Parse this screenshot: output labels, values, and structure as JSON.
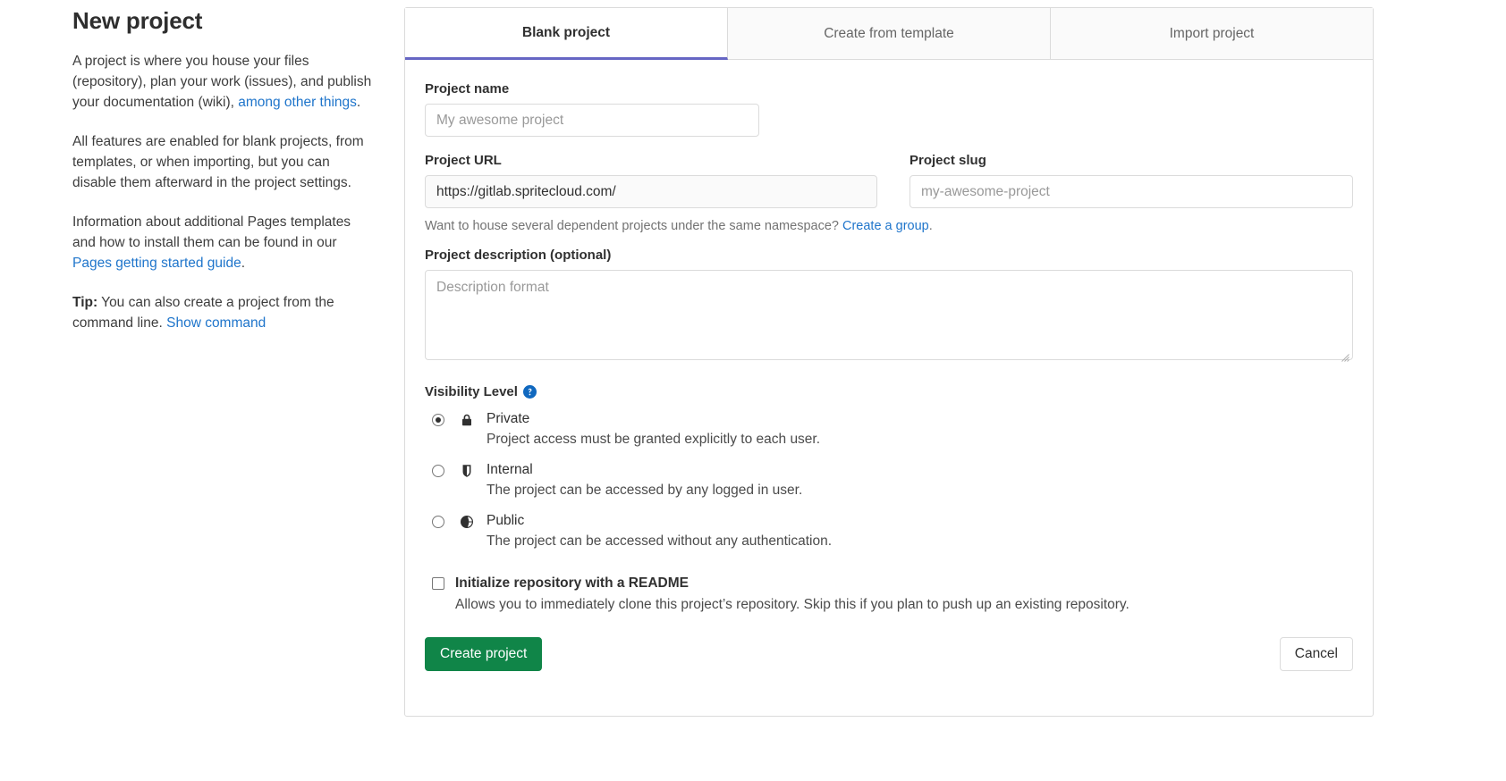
{
  "sidebar": {
    "title": "New project",
    "p1_a": "A project is where you house your files (repository), plan your work (issues), and publish your documentation (wiki), ",
    "p1_link": "among other things",
    "p1_b": ".",
    "p2": "All features are enabled for blank projects, from templates, or when importing, but you can disable them afterward in the project settings.",
    "p3_a": "Information about additional Pages templates and how to install them can be found in our ",
    "p3_link": "Pages getting started guide",
    "p3_b": ".",
    "tip_label": "Tip:",
    "tip_text": " You can also create a project from the command line. ",
    "tip_link": "Show command"
  },
  "tabs": [
    {
      "label": "Blank project",
      "active": true
    },
    {
      "label": "Create from template",
      "active": false
    },
    {
      "label": "Import project",
      "active": false
    }
  ],
  "form": {
    "project_name_label": "Project name",
    "project_name_value": "",
    "project_name_placeholder": "My awesome project",
    "project_url_label": "Project URL",
    "project_url_value": "https://gitlab.spritecloud.com/",
    "project_slug_label": "Project slug",
    "project_slug_value": "",
    "project_slug_placeholder": "my-awesome-project",
    "namespace_hint_text": "Want to house several dependent projects under the same namespace? ",
    "namespace_hint_link": "Create a group",
    "namespace_hint_end": ".",
    "description_label": "Project description (optional)",
    "description_value": "",
    "description_placeholder": "Description format",
    "visibility_label": "Visibility Level",
    "help_icon": "question-circle-icon",
    "visibility_options": [
      {
        "id": "private",
        "icon": "lock-icon",
        "name": "Private",
        "desc": "Project access must be granted explicitly to each user.",
        "selected": true
      },
      {
        "id": "internal",
        "icon": "shield-icon",
        "name": "Internal",
        "desc": "The project can be accessed by any logged in user.",
        "selected": false
      },
      {
        "id": "public",
        "icon": "globe-icon",
        "name": "Public",
        "desc": "The project can be accessed without any authentication.",
        "selected": false
      }
    ],
    "readme_label": "Initialize repository with a README",
    "readme_checked": false,
    "readme_desc": "Allows you to immediately clone this project’s repository. Skip this if you plan to push up an existing repository.",
    "create_button": "Create project",
    "cancel_button": "Cancel"
  },
  "colors": {
    "link": "#1f75cb",
    "active_tab_underline": "#6666c4",
    "create_button_bg": "#108548",
    "help_icon_blue": "#1068bf"
  }
}
